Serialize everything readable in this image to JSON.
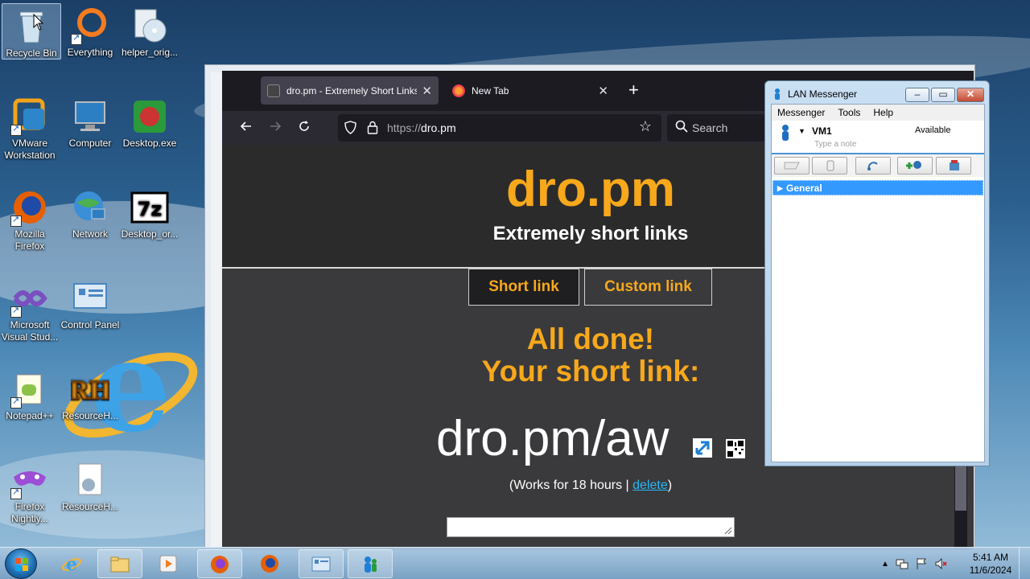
{
  "desktop": {
    "icons": [
      {
        "label": "Recycle Bin",
        "icon": "recycle-bin-icon"
      },
      {
        "label": "Everything",
        "icon": "everything-icon"
      },
      {
        "label": "helper_orig...",
        "icon": "disc-icon"
      },
      {
        "label": "VMware Workstation",
        "icon": "vmware-icon"
      },
      {
        "label": "Computer",
        "icon": "computer-icon"
      },
      {
        "label": "Desktop.exe",
        "icon": "desktop-exe-icon"
      },
      {
        "label": "Mozilla Firefox",
        "icon": "firefox-icon"
      },
      {
        "label": "Network",
        "icon": "network-icon"
      },
      {
        "label": "Desktop_or...",
        "icon": "7zip-icon"
      },
      {
        "label": "Microsoft Visual Stud...",
        "icon": "visual-studio-icon"
      },
      {
        "label": "Control Panel",
        "icon": "control-panel-icon"
      },
      {
        "label": "Notepad++",
        "icon": "notepadpp-icon"
      },
      {
        "label": "ResourceH...",
        "icon": "resource-hacker-icon"
      },
      {
        "label": "Firefox Nightly...",
        "icon": "firefox-nightly-icon"
      },
      {
        "label": "ResourceH...",
        "icon": "resource-file-icon"
      }
    ]
  },
  "browser": {
    "tabs": [
      {
        "title": "dro.pm - Extremely Short Links",
        "close": "✕"
      },
      {
        "title": "New Tab",
        "close": "✕"
      }
    ],
    "new_tab": "+",
    "url_prefix": "https://",
    "url_host": "dro.pm",
    "search_placeholder": "Search"
  },
  "page": {
    "logo": "dro.pm",
    "tagline": "Extremely short links",
    "tab_short": "Short link",
    "tab_custom": "Custom link",
    "done_line1": "All done!",
    "done_line2": "Your short link:",
    "short_link": "dro.pm/aw",
    "works_prefix": "(Works for 18 hours | ",
    "delete_label": "delete",
    "works_suffix": ")",
    "accent_color": "#f7a81b"
  },
  "lan": {
    "title": "LAN Messenger",
    "menu": [
      "Messenger",
      "Tools",
      "Help"
    ],
    "user": "VM1",
    "status": "Available",
    "note_placeholder": "Type a note",
    "group": "General"
  },
  "taskbar": {
    "time": "5:41 AM",
    "date": "11/6/2024"
  }
}
